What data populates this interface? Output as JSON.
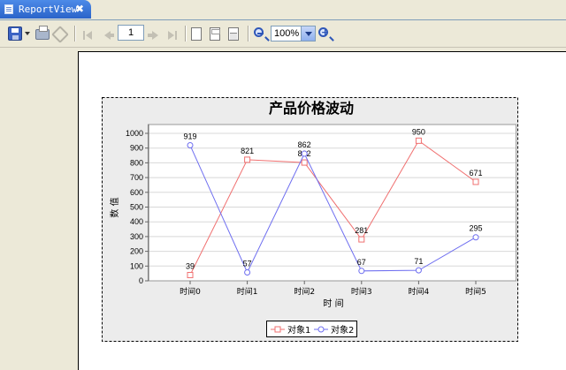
{
  "tab": {
    "title": "ReportView",
    "close_glyph": "✖"
  },
  "toolbar": {
    "page_number": "1",
    "zoom_value": "100%",
    "icons": [
      "save-icon",
      "dropdown-arrow-icon",
      "print-icon",
      "tool-icon",
      "first-page-icon",
      "prev-page-icon",
      "next-page-icon",
      "last-page-icon",
      "page-icon",
      "page-setup-icon",
      "page-layout-icon",
      "zoom-out-icon",
      "zoom-in-icon"
    ]
  },
  "chart_data": {
    "type": "line",
    "title": "产品价格波动",
    "xlabel": "时 间",
    "ylabel": "数 值",
    "categories": [
      "时间0",
      "时间1",
      "时间2",
      "时间3",
      "时间4",
      "时间5"
    ],
    "ylim": [
      0,
      1000
    ],
    "yticks": [
      0,
      100,
      200,
      300,
      400,
      500,
      600,
      700,
      800,
      900,
      1000
    ],
    "grid": true,
    "legend": "bottom",
    "series": [
      {
        "name": "对象1",
        "values": [
          39,
          821,
          802,
          281,
          950,
          671
        ],
        "color": "#f07070",
        "marker": "square"
      },
      {
        "name": "对象2",
        "values": [
          919,
          57,
          862,
          67,
          71,
          295
        ],
        "color": "#6e6ef0",
        "marker": "circle"
      }
    ],
    "colors": {
      "plot_bg": "#ffffff",
      "chart_bg": "#ececec",
      "grid": "#d8d8d8"
    }
  }
}
